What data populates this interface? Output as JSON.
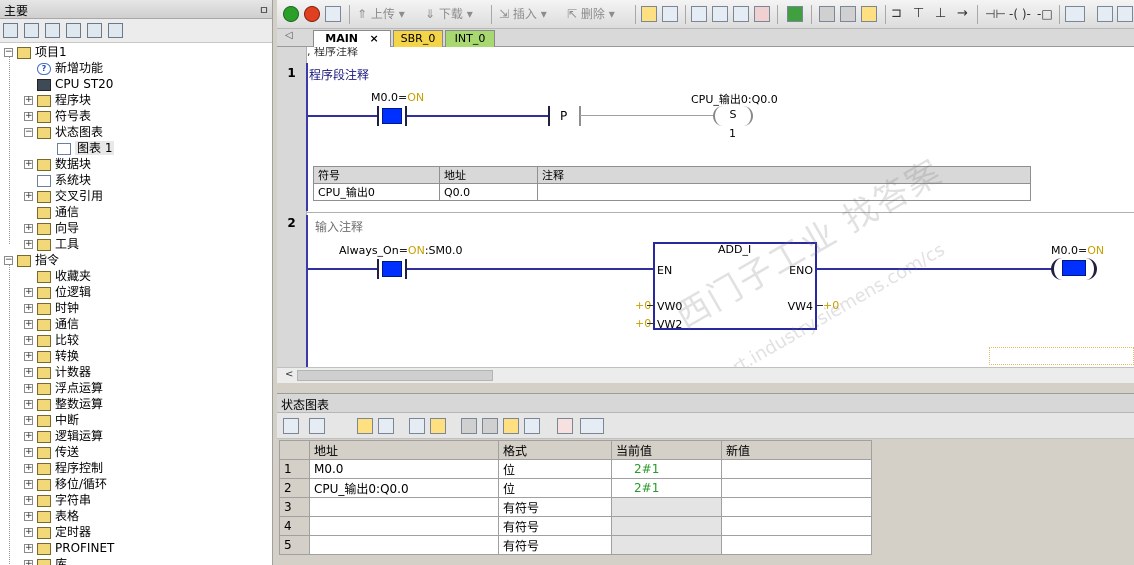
{
  "left_panel": {
    "title": "主要",
    "pin": "ㅁ",
    "tree": [
      {
        "label": "项目1",
        "level": 0,
        "expander": "−",
        "icon": "project-icon"
      },
      {
        "label": "新增功能",
        "level": 1,
        "expander": "",
        "icon": "help-icon"
      },
      {
        "label": "CPU ST20",
        "level": 1,
        "expander": "",
        "icon": "cpu-icon"
      },
      {
        "label": "程序块",
        "level": 1,
        "expander": "+",
        "icon": "folder-icon"
      },
      {
        "label": "符号表",
        "level": 1,
        "expander": "+",
        "icon": "folder-icon"
      },
      {
        "label": "状态图表",
        "level": 1,
        "expander": "−",
        "icon": "folder-icon"
      },
      {
        "label": "图表 1",
        "level": 2,
        "expander": "",
        "icon": "chart-table-icon"
      },
      {
        "label": "数据块",
        "level": 1,
        "expander": "+",
        "icon": "folder-icon"
      },
      {
        "label": "系统块",
        "level": 1,
        "expander": "",
        "icon": "doc-icon"
      },
      {
        "label": "交叉引用",
        "level": 1,
        "expander": "+",
        "icon": "folder-icon"
      },
      {
        "label": "通信",
        "level": 1,
        "expander": "",
        "icon": "comm-icon"
      },
      {
        "label": "向导",
        "level": 1,
        "expander": "+",
        "icon": "wizard-icon"
      },
      {
        "label": "工具",
        "level": 1,
        "expander": "+",
        "icon": "folder-icon"
      },
      {
        "label": "指令",
        "level": 0,
        "expander": "−",
        "icon": "folder-icon"
      },
      {
        "label": "收藏夹",
        "level": 1,
        "expander": "",
        "icon": "favorites-icon"
      },
      {
        "label": "位逻辑",
        "level": 1,
        "expander": "+",
        "icon": "bit-logic-icon"
      },
      {
        "label": "时钟",
        "level": 1,
        "expander": "+",
        "icon": "clock-icon"
      },
      {
        "label": "通信",
        "level": 1,
        "expander": "+",
        "icon": "comm-icon"
      },
      {
        "label": "比较",
        "level": 1,
        "expander": "+",
        "icon": "compare-icon"
      },
      {
        "label": "转换",
        "level": 1,
        "expander": "+",
        "icon": "convert-icon"
      },
      {
        "label": "计数器",
        "level": 1,
        "expander": "+",
        "icon": "counter-icon"
      },
      {
        "label": "浮点运算",
        "level": 1,
        "expander": "+",
        "icon": "float-icon"
      },
      {
        "label": "整数运算",
        "level": 1,
        "expander": "+",
        "icon": "integer-icon"
      },
      {
        "label": "中断",
        "level": 1,
        "expander": "+",
        "icon": "interrupt-icon"
      },
      {
        "label": "逻辑运算",
        "level": 1,
        "expander": "+",
        "icon": "logic-icon"
      },
      {
        "label": "传送",
        "level": 1,
        "expander": "+",
        "icon": "move-icon"
      },
      {
        "label": "程序控制",
        "level": 1,
        "expander": "+",
        "icon": "program-control-icon"
      },
      {
        "label": "移位/循环",
        "level": 1,
        "expander": "+",
        "icon": "shift-icon"
      },
      {
        "label": "字符串",
        "level": 1,
        "expander": "+",
        "icon": "string-icon"
      },
      {
        "label": "表格",
        "level": 1,
        "expander": "+",
        "icon": "table-icon"
      },
      {
        "label": "定时器",
        "level": 1,
        "expander": "+",
        "icon": "timer-icon"
      },
      {
        "label": "PROFINET",
        "level": 1,
        "expander": "+",
        "icon": "profinet-icon"
      },
      {
        "label": "库",
        "level": 1,
        "expander": "+",
        "icon": "library-icon"
      }
    ]
  },
  "toolbar": {
    "upload": "上传",
    "download": "下载",
    "insert": "插入",
    "delete": "删除"
  },
  "tabs": [
    {
      "label": "MAIN",
      "active": true,
      "close": "×"
    },
    {
      "label": "SBR_0",
      "active": false
    },
    {
      "label": "INT_0",
      "active": false
    }
  ],
  "editor": {
    "top_comment": "程序注释",
    "network1": {
      "number": "1",
      "comment": "程序段注释",
      "contact": {
        "name": "M0.0",
        "sep": "=",
        "state": "ON"
      },
      "p_label": "P",
      "coil": {
        "name": "CPU_输出0:Q0.0",
        "instr": "S",
        "count": "1"
      },
      "symbol_table": {
        "headers": [
          "符号",
          "地址",
          "注释"
        ],
        "rows": [
          [
            "CPU_输出0",
            "Q0.0",
            ""
          ]
        ]
      }
    },
    "network2": {
      "number": "2",
      "comment": "输入注释",
      "contact": {
        "name": "Always_On",
        "sep": "=",
        "state": "ON",
        "addr": ":SM0.0"
      },
      "box": {
        "title": "ADD_I",
        "en": "EN",
        "eno": "ENO",
        "in1": "VW0",
        "in2": "VW2",
        "out": "VW4",
        "in1_val": "+0",
        "in2_val": "+0",
        "out_val": "+0"
      },
      "coil": {
        "name": "M0.0",
        "sep": "=",
        "state": "ON"
      }
    },
    "watermark": "西门子工业 找答案",
    "watermark_url": "support.industry.siemens.com/cs"
  },
  "status_chart": {
    "title": "状态图表",
    "headers": [
      "",
      "地址",
      "格式",
      "当前值",
      "新值"
    ],
    "rows": [
      {
        "num": "1",
        "addr": "M0.0",
        "fmt": "位",
        "cur": "2#1",
        "new": ""
      },
      {
        "num": "2",
        "addr": "CPU_输出0:Q0.0",
        "fmt": "位",
        "cur": "2#1",
        "new": ""
      },
      {
        "num": "3",
        "addr": "",
        "fmt": "有符号",
        "cur": "",
        "new": ""
      },
      {
        "num": "4",
        "addr": "",
        "fmt": "有符号",
        "cur": "",
        "new": ""
      },
      {
        "num": "5",
        "addr": "",
        "fmt": "有符号",
        "cur": "",
        "new": ""
      }
    ]
  },
  "colors": {
    "contact_fill": "#0030ff",
    "on_state": "#c8a000",
    "current_value": "#2a9a2a"
  }
}
